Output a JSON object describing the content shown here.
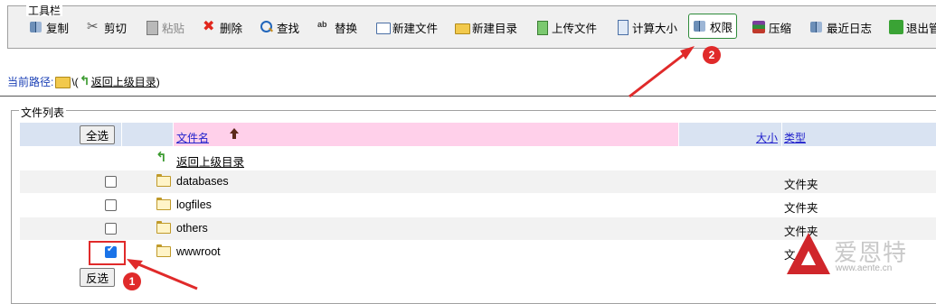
{
  "toolbar": {
    "legend": "工具栏",
    "buttons": [
      {
        "label": "复制",
        "icon": "copy-icon"
      },
      {
        "label": "剪切",
        "icon": "scissors-icon"
      },
      {
        "label": "粘贴",
        "icon": "paste-icon"
      },
      {
        "label": "删除",
        "icon": "delete-icon"
      },
      {
        "label": "查找",
        "icon": "search-icon"
      },
      {
        "label": "替换",
        "icon": "replace-icon"
      },
      {
        "label": "新建文件",
        "icon": "new-file-icon"
      },
      {
        "label": "新建目录",
        "icon": "new-folder-icon"
      },
      {
        "label": "上传文件",
        "icon": "upload-icon"
      },
      {
        "label": "计算大小",
        "icon": "calculator-icon"
      },
      {
        "label": "权限",
        "icon": "permission-icon"
      },
      {
        "label": "压缩",
        "icon": "archive-icon"
      },
      {
        "label": "最近日志",
        "icon": "log-icon"
      },
      {
        "label": "退出管",
        "icon": "exit-icon"
      }
    ]
  },
  "path": {
    "label": "当前路径:",
    "separator": "\\(",
    "up_link": "返回上级目录",
    "close": ")"
  },
  "file_list": {
    "legend": "文件列表",
    "select_all": "全选",
    "invert_selection": "反选",
    "columns": {
      "name": "文件名",
      "size": "大小",
      "type": "类型"
    },
    "up_row_label": "返回上级目录",
    "rows": [
      {
        "name": "databases",
        "type": "文件夹",
        "checked": false
      },
      {
        "name": "logfiles",
        "type": "文件夹",
        "checked": false
      },
      {
        "name": "others",
        "type": "文件夹",
        "checked": false
      },
      {
        "name": "wwwroot",
        "type": "文",
        "checked": true
      }
    ]
  },
  "annotations": {
    "badge1": "1",
    "badge2": "2"
  },
  "watermark": {
    "text": "爱恩特",
    "url": "www.aente.cn"
  },
  "colors": {
    "accent_red": "#e02a2a",
    "header_blue": "#d9e3f2",
    "header_pink": "#ffd0ea",
    "highlight_green": "#2e8b3a"
  }
}
